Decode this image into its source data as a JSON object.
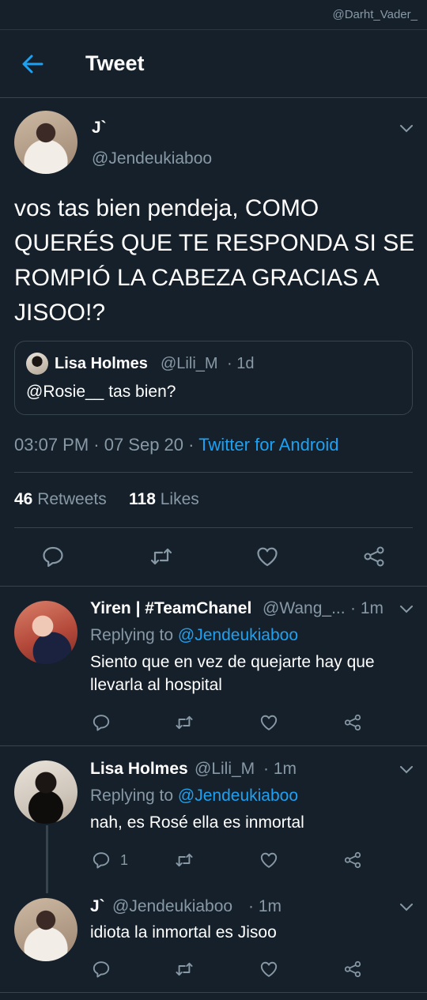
{
  "watermark": "@Darht_Vader_",
  "header": {
    "title": "Tweet"
  },
  "main_tweet": {
    "display_name": "J`",
    "handle": "@Jendeukiaboo",
    "text": "vos tas bien pendeja, COMO QUERÉS QUE TE RESPONDA SI SE ROMPIÓ LA CABEZA GRACIAS A JISOO!?",
    "quote": {
      "display_name": "Lisa Holmes",
      "handle": "@Lili_M",
      "time": "· 1d",
      "text": "@Rosie__ tas bien?"
    },
    "timestamp": "03:07 PM · 07 Sep 20 · ",
    "source": "Twitter for Android",
    "retweets_count": "46",
    "retweets_label": "Retweets",
    "likes_count": "118",
    "likes_label": "Likes"
  },
  "replies": [
    {
      "display_name": "Yiren | #TeamChanel",
      "handle": "@Wang_...",
      "time": "· 1m",
      "replying_prefix": "Replying to ",
      "replying_to": "@Jendeukiaboo",
      "text_line1": "Siento que en vez de quejarte hay que",
      "text_line2": "llevarla al hospital"
    },
    {
      "display_name": "Lisa Holmes",
      "handle": "@Lili_M",
      "time": "· 1m",
      "replying_prefix": "Replying to ",
      "replying_to": "@Jendeukiaboo",
      "text": "nah, es Rosé ella es inmortal",
      "reply_count": "1"
    },
    {
      "display_name": "J`",
      "handle": "@Jendeukiaboo",
      "time": "· 1m",
      "text": "idiota la inmortal es Jisoo"
    }
  ],
  "icons": {
    "back": "arrow-left-icon",
    "reply": "comment-icon",
    "retweet": "retweet-icon",
    "like": "heart-icon",
    "share": "share-icon",
    "more": "chevron-down-icon"
  },
  "colors": {
    "background": "#15202b",
    "accent": "#1da1f2",
    "muted": "#8899a6",
    "divider": "#38444d"
  }
}
